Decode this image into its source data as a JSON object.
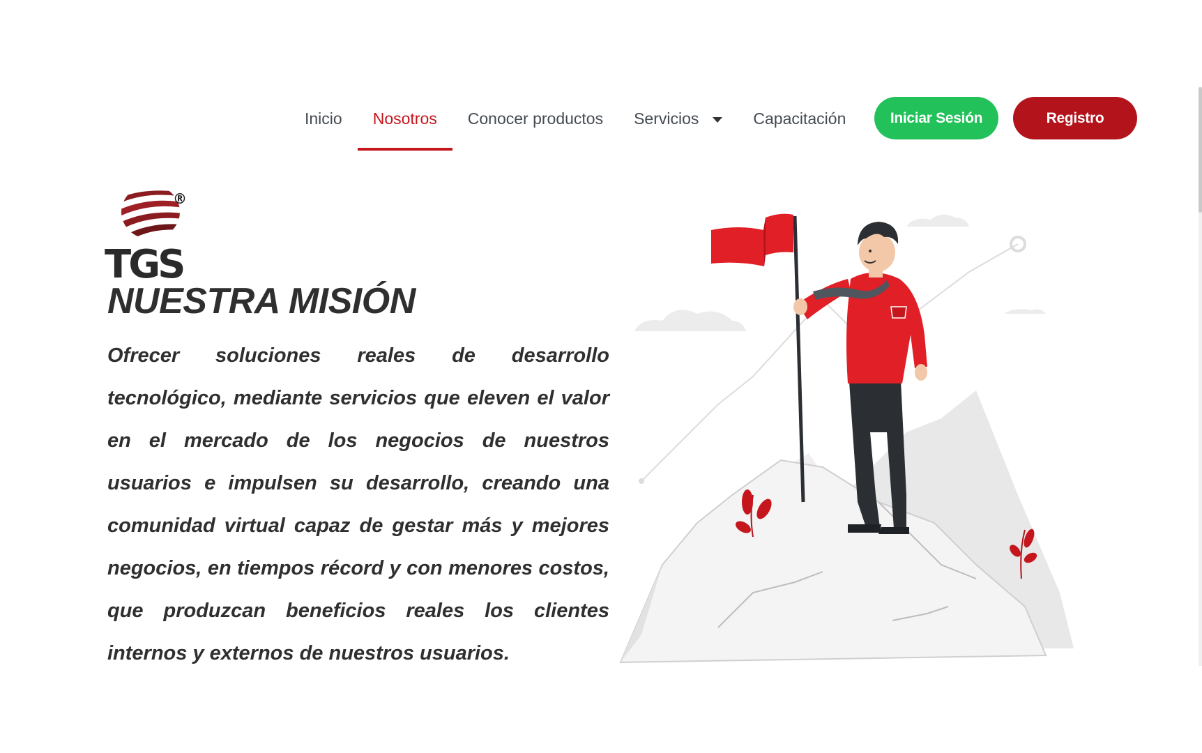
{
  "nav": {
    "items": [
      {
        "label": "Inicio",
        "active": false
      },
      {
        "label": "Nosotros",
        "active": true
      },
      {
        "label": "Conocer productos",
        "active": false
      },
      {
        "label": "Servicios",
        "active": false,
        "has_dropdown": true
      },
      {
        "label": "Capacitación",
        "active": false
      }
    ],
    "login_label": "Iniciar Sesión",
    "register_label": "Registro"
  },
  "logo": {
    "text": "TGS",
    "registered_mark": "®"
  },
  "mission": {
    "title": "NUESTRA MISIÓN",
    "text": "Ofrecer soluciones reales de desarrollo tecnológico, mediante servicios que eleven el valor en el mercado de los negocios de nuestros usuarios e impulsen su desarrollo, creando una comunidad virtual capaz de gestar más y mejores negocios, en tiempos récord y con menores costos, que produzcan beneficios reales los clientes internos y externos de nuestros usuarios."
  },
  "illustration": {
    "icon": "person-with-flag-on-mountain-illustration"
  },
  "colors": {
    "accent_red": "#c4161c",
    "login_green": "#22c15a",
    "register_red": "#b3141c",
    "text_dark": "#2f2f2f"
  }
}
